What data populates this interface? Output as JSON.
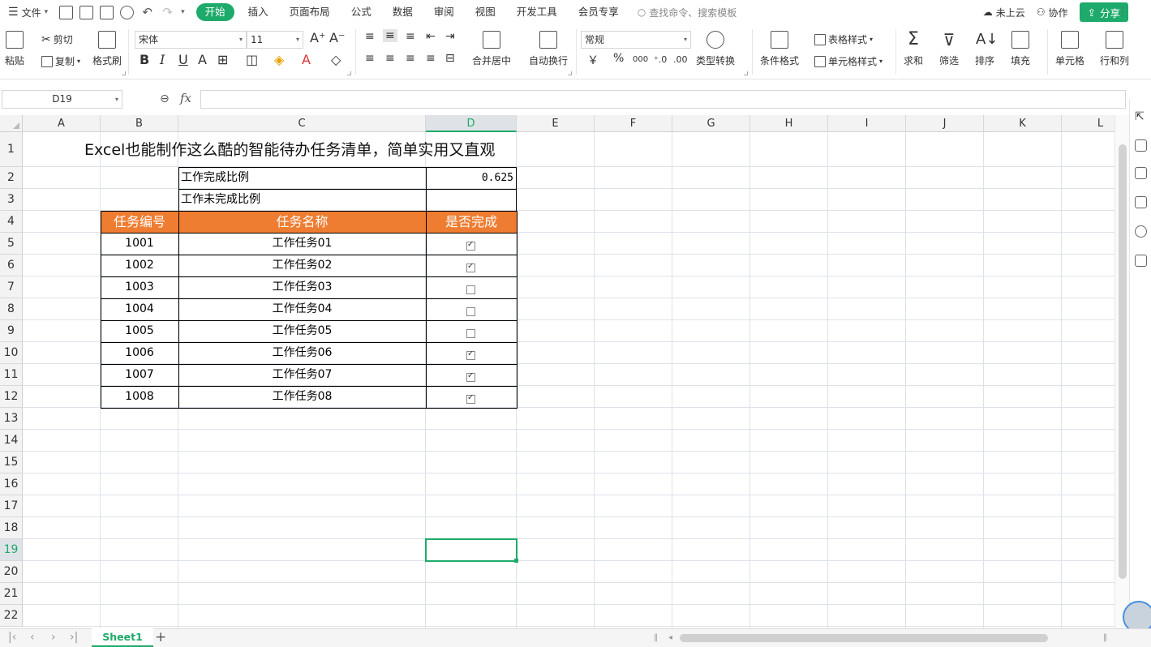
{
  "menubar": {
    "file": "文件",
    "tabs": [
      "开始",
      "插入",
      "页面布局",
      "公式",
      "数据",
      "审阅",
      "视图",
      "开发工具",
      "会员专享"
    ],
    "search": "查找命令、搜索模板",
    "cloud": "未上云",
    "collab": "协作",
    "share": "分享"
  },
  "ribbon": {
    "paste": "粘贴",
    "cut": "剪切",
    "copy": "复制",
    "format_painter": "格式刷",
    "font_name": "宋体",
    "font_size": "11",
    "merge_center": "合并居中",
    "wrap_text": "自动换行",
    "number_format": "常规",
    "currency": "￥",
    "percent": "%",
    "thousands": "000",
    "type_convert": "类型转换",
    "cond_format": "条件格式",
    "table_style": "表格样式",
    "cell_style": "单元格样式",
    "sum": "求和",
    "filter": "筛选",
    "sort": "排序",
    "fill": "填充",
    "cell": "单元格",
    "rowcol": "行和列"
  },
  "formula": {
    "name_box": "D19",
    "fx": "fx",
    "content": ""
  },
  "sheet": {
    "columns": [
      "A",
      "B",
      "C",
      "D",
      "E",
      "F",
      "G",
      "H",
      "I",
      "J",
      "K",
      "L"
    ],
    "active_col": "D",
    "rows": [
      "1",
      "2",
      "3",
      "4",
      "5",
      "6",
      "7",
      "8",
      "9",
      "10",
      "11",
      "12",
      "13",
      "14",
      "15",
      "16",
      "17",
      "18",
      "19",
      "20",
      "21",
      "22"
    ],
    "active_row": "19",
    "title": "Excel也能制作这么酷的智能待办任务清单，简单实用又直观",
    "done_ratio_label": "工作完成比例",
    "done_ratio_value": "0.625",
    "undone_ratio_label": "工作未完成比例",
    "undone_ratio_value": "",
    "headers": [
      "任务编号",
      "任务名称",
      "是否完成"
    ],
    "tasks": [
      {
        "id": "1001",
        "name": "工作任务01",
        "done": true
      },
      {
        "id": "1002",
        "name": "工作任务02",
        "done": true
      },
      {
        "id": "1003",
        "name": "工作任务03",
        "done": false
      },
      {
        "id": "1004",
        "name": "工作任务04",
        "done": false
      },
      {
        "id": "1005",
        "name": "工作任务05",
        "done": false
      },
      {
        "id": "1006",
        "name": "工作任务06",
        "done": true
      },
      {
        "id": "1007",
        "name": "工作任务07",
        "done": true
      },
      {
        "id": "1008",
        "name": "工作任务08",
        "done": true
      }
    ]
  },
  "sheet_tabs": {
    "active": "Sheet1",
    "add": "+"
  },
  "colors": {
    "accent": "#1eaa6a",
    "header_orange": "#ee7d31"
  }
}
